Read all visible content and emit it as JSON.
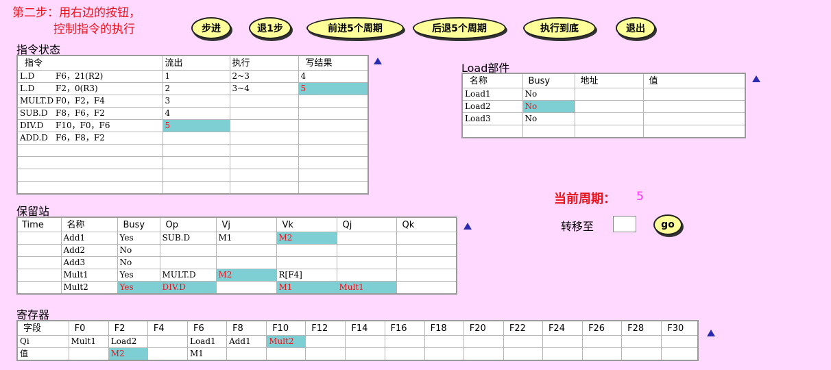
{
  "instruction": {
    "line1": "第二步：用右边的按钮，",
    "line2": "控制指令的执行"
  },
  "buttons": {
    "step": "步进",
    "back1": "退1步",
    "fwd5": "前进5个周期",
    "back5": "后退5个周期",
    "run_end": "执行到底",
    "exit": "退出"
  },
  "instr_status": {
    "title": "指令状态",
    "headers": [
      "指令",
      "流出",
      "执行",
      "写结果"
    ],
    "rows": [
      {
        "op": "L.D",
        "args": "F6，21(R2)",
        "issue": "1",
        "exec": "2~3",
        "write": "4"
      },
      {
        "op": "L.D",
        "args": "F2，0(R3)",
        "issue": "2",
        "exec": "3~4",
        "write": "5"
      },
      {
        "op": "MULT.D",
        "args": "F0，F2，F4",
        "issue": "3",
        "exec": "",
        "write": ""
      },
      {
        "op": "SUB.D",
        "args": "F8，F6，F2",
        "issue": "4",
        "exec": "",
        "write": ""
      },
      {
        "op": "DIV.D",
        "args": "F10，F0，F6",
        "issue": "5",
        "exec": "",
        "write": ""
      },
      {
        "op": "ADD.D",
        "args": "F6，F8，F2",
        "issue": "",
        "exec": "",
        "write": ""
      }
    ]
  },
  "load": {
    "title": "Load部件",
    "headers": [
      "名称",
      "Busy",
      "地址",
      "值"
    ],
    "rows": [
      {
        "name": "Load1",
        "busy": "No",
        "addr": "",
        "val": ""
      },
      {
        "name": "Load2",
        "busy": "No",
        "addr": "",
        "val": ""
      },
      {
        "name": "Load3",
        "busy": "No",
        "addr": "",
        "val": ""
      }
    ]
  },
  "cycle": {
    "label": "当前周期：",
    "value": "5"
  },
  "goto": {
    "label": "转移至",
    "value": "",
    "button": "go"
  },
  "rs": {
    "title": "保留站",
    "headers": [
      "Time",
      "名称",
      "Busy",
      "Op",
      "Vj",
      "Vk",
      "Qj",
      "Qk"
    ],
    "rows": [
      {
        "time": "",
        "name": "Add1",
        "busy": "Yes",
        "op": "SUB.D",
        "vj": "M1",
        "vk": "M2",
        "qj": "",
        "qk": ""
      },
      {
        "time": "",
        "name": "Add2",
        "busy": "No",
        "op": "",
        "vj": "",
        "vk": "",
        "qj": "",
        "qk": ""
      },
      {
        "time": "",
        "name": "Add3",
        "busy": "No",
        "op": "",
        "vj": "",
        "vk": "",
        "qj": "",
        "qk": ""
      },
      {
        "time": "",
        "name": "Mult1",
        "busy": "Yes",
        "op": "MULT.D",
        "vj": "M2",
        "vk": "R[F4]",
        "qj": "",
        "qk": ""
      },
      {
        "time": "",
        "name": "Mult2",
        "busy": "Yes",
        "op": "DIV.D",
        "vj": "",
        "vk": "M1",
        "qj": "Mult1",
        "qk": ""
      }
    ]
  },
  "regs": {
    "title": "寄存器",
    "headers": [
      "字段",
      "F0",
      "F2",
      "F4",
      "F6",
      "F8",
      "F10",
      "F12",
      "F14",
      "F16",
      "F18",
      "F20",
      "F22",
      "F24",
      "F26",
      "F28",
      "F30"
    ],
    "qi": [
      "Qi",
      "Mult1",
      "Load2",
      "",
      "Load1",
      "Add1",
      "Mult2",
      "",
      "",
      "",
      "",
      "",
      "",
      "",
      "",
      "",
      ""
    ],
    "val": [
      "值",
      "",
      "M2",
      "",
      "M1",
      "",
      "",
      "",
      "",
      "",
      "",
      "",
      "",
      "",
      "",
      "",
      ""
    ]
  },
  "colors": {
    "background": "#ffd9ff",
    "highlight": "#7ecfd4",
    "changed": "#e8141c",
    "button": "#ffff99",
    "arrow": "#2b2baf"
  }
}
